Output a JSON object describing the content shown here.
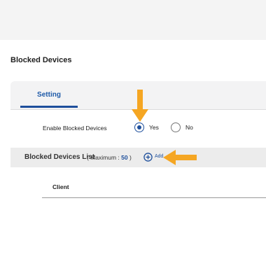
{
  "page": {
    "section_title": "Blocked Devices"
  },
  "tabs": [
    {
      "label": "Setting",
      "active": true
    }
  ],
  "setting": {
    "enable_label": "Enable Blocked Devices",
    "options": [
      {
        "label": "Yes",
        "checked": true
      },
      {
        "label": "No",
        "checked": false
      }
    ]
  },
  "list": {
    "title": "Blocked Devices List",
    "max_prefix": "( Maximum : ",
    "max_value": "50",
    "max_suffix": " )",
    "add_label": "Add",
    "columns": [
      "Client"
    ]
  },
  "colors": {
    "accent": "#1e4f9c",
    "annotation_arrow": "#f5a623"
  }
}
